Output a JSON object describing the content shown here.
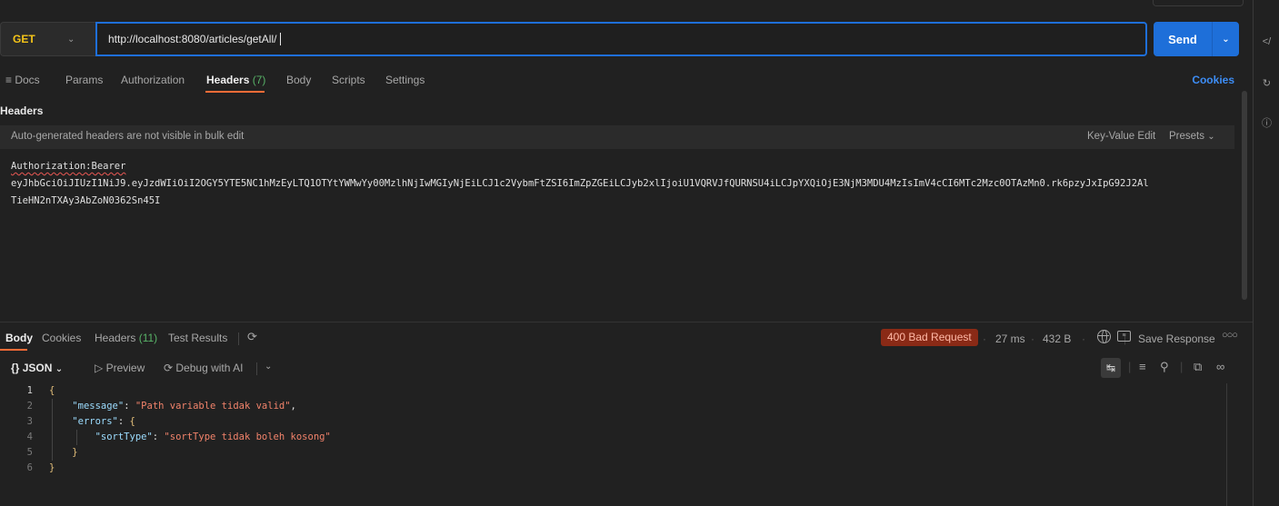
{
  "request": {
    "method": "GET",
    "url": "http://localhost:8080/articles/getAll/",
    "send_label": "Send"
  },
  "request_tabs": {
    "docs": "Docs",
    "params": "Params",
    "authorization": "Authorization",
    "headers": "Headers",
    "headers_count": "(7)",
    "body": "Body",
    "scripts": "Scripts",
    "settings": "Settings",
    "cookies": "Cookies"
  },
  "headers_section": {
    "title": "Headers",
    "bulk_note": "Auto-generated headers are not visible in bulk edit",
    "key_value_edit": "Key-Value Edit",
    "presets": "Presets",
    "bulk_text": {
      "line1_key": "Authorization:Bearer",
      "line2": "eyJhbGciOiJIUzI1NiJ9.eyJzdWIiOiI2OGY5YTE5NC1hMzEyLTQ1OTYtYWMwYy00MzlhNjIwMGIyNjEiLCJ1c2VybmFtZSI6ImZpZGEiLCJyb2xlIjoiU1VQRVJfQURNSU4iLCJpYXQiOjE3NjM3MDU4MzIsImV4cCI6MTc2Mzc0OTAzMn0.rk6pzyJxIpG92J2Al",
      "line3": "TieHN2nTXAy3AbZoN0362Sn45I"
    }
  },
  "response_tabs": {
    "body": "Body",
    "cookies": "Cookies",
    "headers": "Headers",
    "headers_count": "(11)",
    "test_results": "Test Results"
  },
  "response_meta": {
    "status": "400 Bad Request",
    "time": "27 ms",
    "size": "432 B",
    "save_response": "Save Response"
  },
  "json_toolbar": {
    "format": "JSON",
    "preview": "Preview",
    "debug": "Debug with AI"
  },
  "response_body": {
    "line_numbers": [
      "1",
      "2",
      "3",
      "4",
      "5",
      "6"
    ],
    "message_key": "\"message\"",
    "message_value": "\"Path variable tidak valid\"",
    "errors_key": "\"errors\"",
    "sort_key": "\"sortType\"",
    "sort_value": "\"sortType tidak boleh kosong\""
  },
  "colors": {
    "accent_blue": "#1e6fd9",
    "accent_orange": "#ff6c37",
    "error_badge": "#8a2a16",
    "method_get": "#f5c518"
  },
  "icons": {
    "rail": [
      "code-icon",
      "refresh-icon",
      "info-icon"
    ]
  }
}
